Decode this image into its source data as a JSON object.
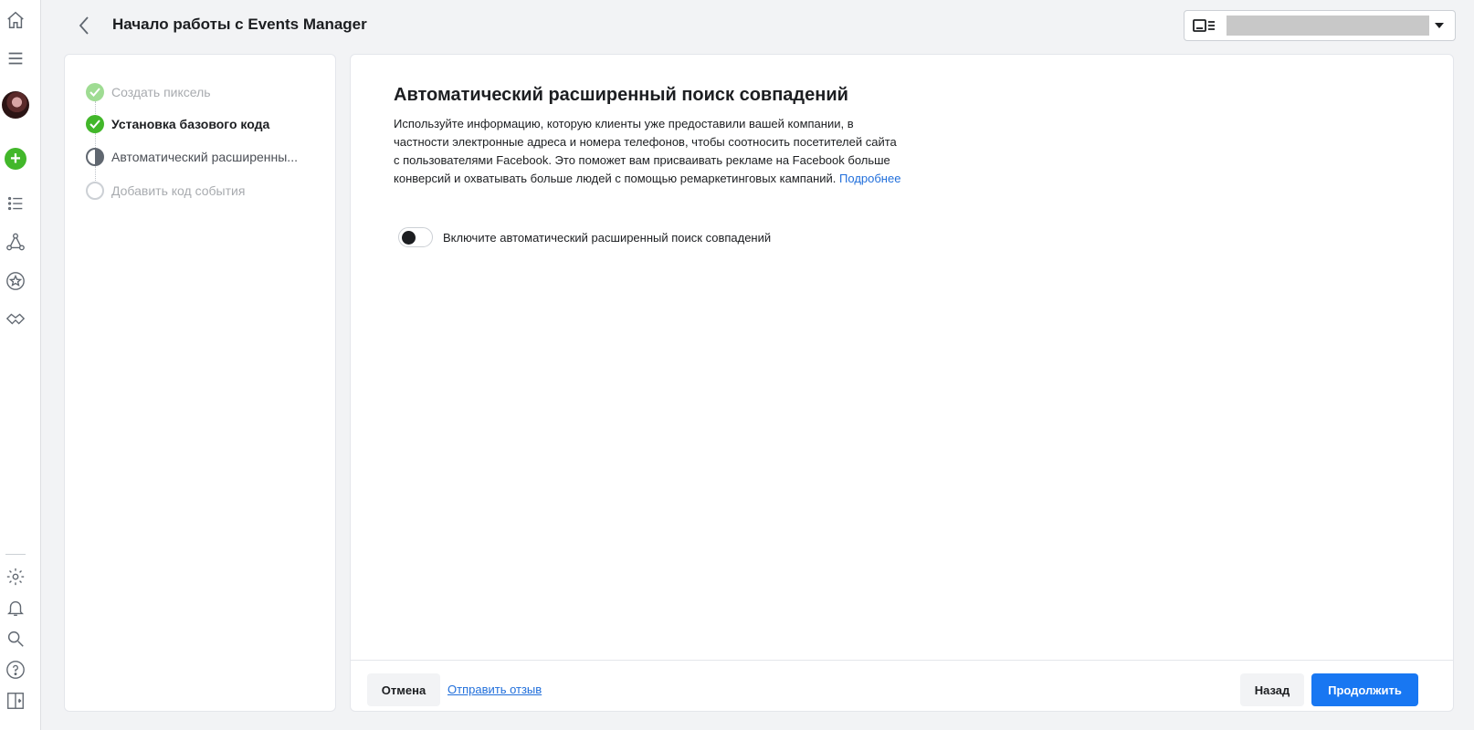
{
  "header": {
    "title": "Начало работы с Events Manager",
    "back_icon": "chevron-left-icon",
    "account_select_icon": "business-card-icon"
  },
  "rail": {
    "icons": [
      "home-icon",
      "menu-icon",
      "avatar",
      "add-icon",
      "list-icon",
      "network-icon",
      "star-icon",
      "handshake-icon",
      "settings-icon",
      "bell-icon",
      "search-icon",
      "help-icon",
      "sidebar-toggle-icon"
    ],
    "add_color": "#42b72a"
  },
  "steps": [
    {
      "label": "Создать пиксель",
      "state": "done-faded"
    },
    {
      "label": "Установка базового кода",
      "state": "done"
    },
    {
      "label": "Автоматический расширенны...",
      "state": "current"
    },
    {
      "label": "Добавить код события",
      "state": "pending"
    }
  ],
  "main": {
    "title": "Автоматический расширенный поиск совпадений",
    "description": "Используйте информацию, которую клиенты уже предоставили вашей компании, в частности электронные адреса и номера телефонов, чтобы соотносить посетителей сайта с пользователями Facebook. Это поможет вам присваивать рекламе на Facebook больше конверсий и охватывать больше людей с помощью ремаркетинговых кампаний.",
    "learn_more": "Подробнее",
    "toggle_label": "Включите автоматический расширенный поиск совпадений",
    "toggle_on": false
  },
  "footer": {
    "cancel": "Отмена",
    "feedback": "Отправить отзыв",
    "back": "Назад",
    "continue": "Продолжить"
  },
  "colors": {
    "accent": "#1877f2",
    "link": "#216fdb",
    "success": "#42b72a",
    "background": "#f2f3f5"
  }
}
